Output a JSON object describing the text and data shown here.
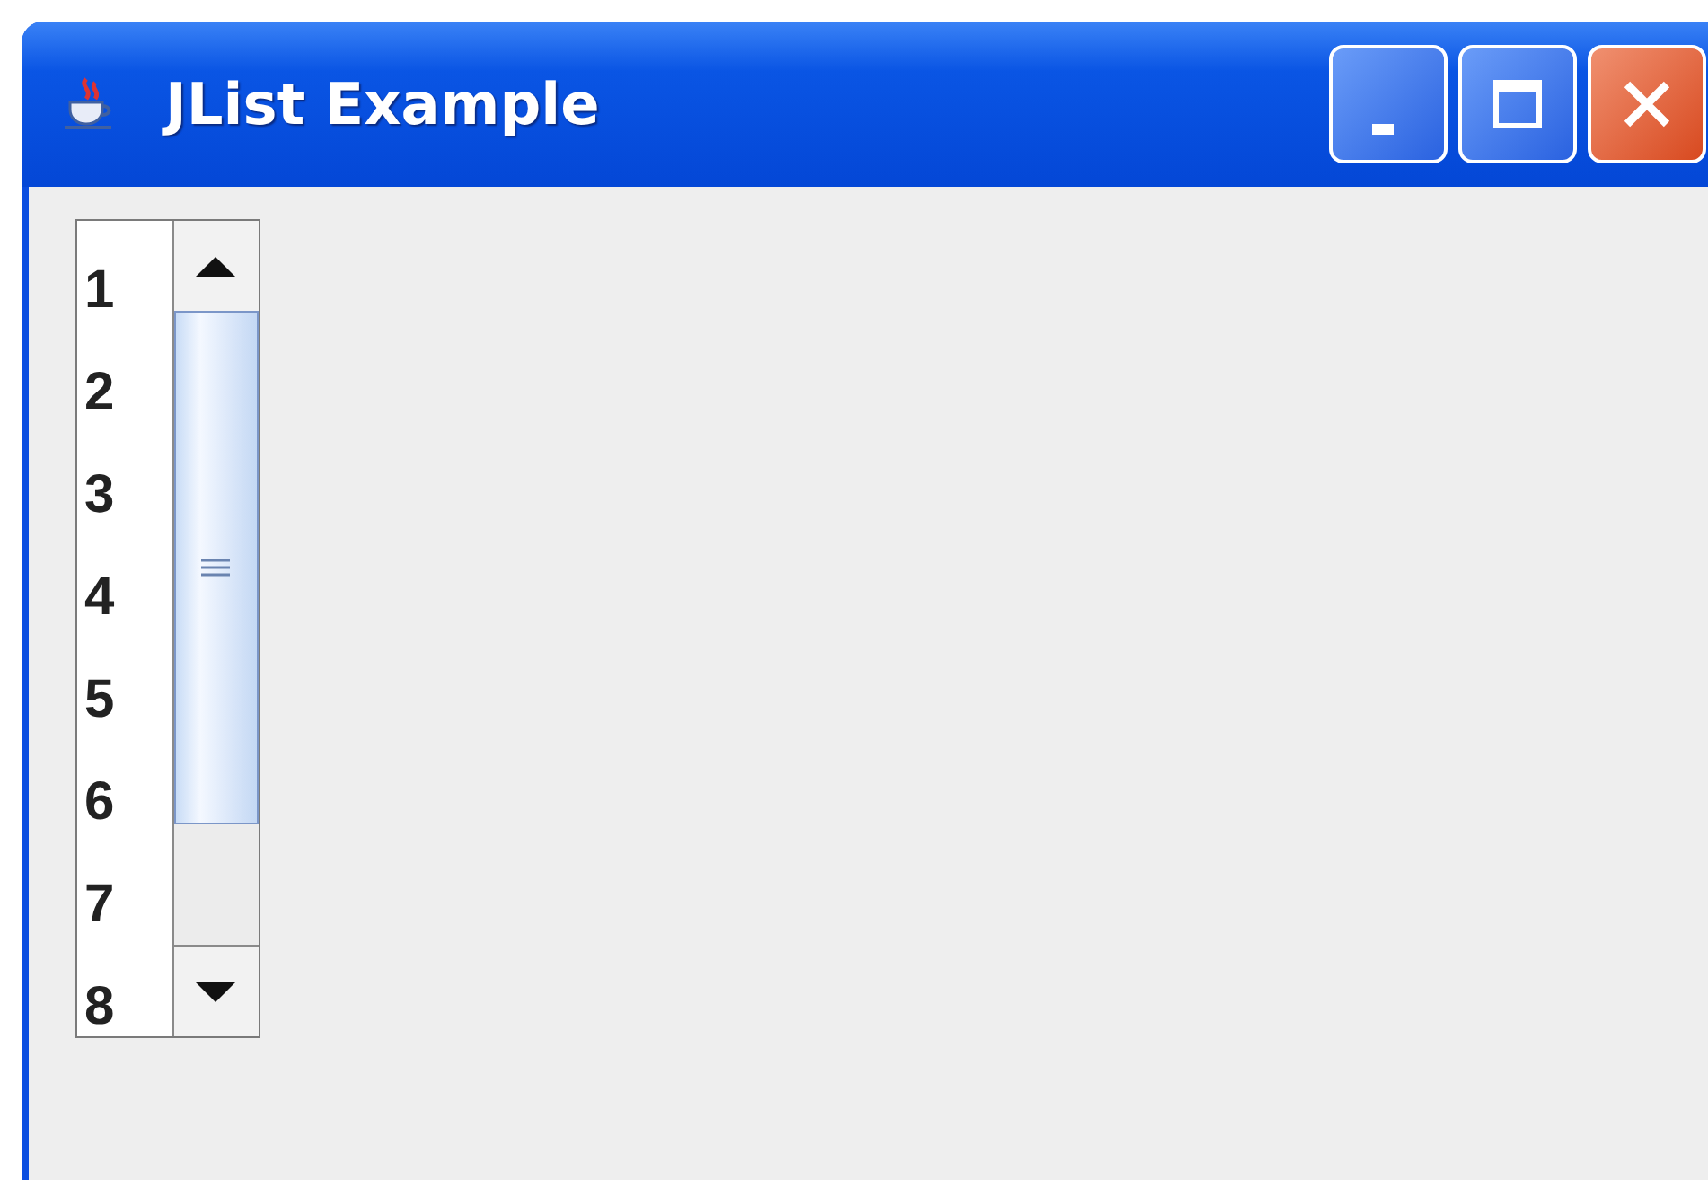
{
  "window": {
    "title": "JList Example"
  },
  "list": {
    "items": [
      "1",
      "2",
      "3",
      "4",
      "5",
      "6",
      "7",
      "8"
    ]
  }
}
